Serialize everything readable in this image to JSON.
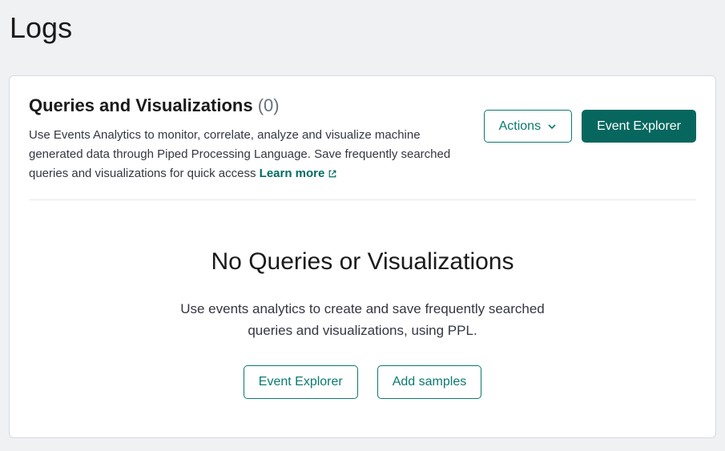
{
  "page": {
    "title": "Logs"
  },
  "panel": {
    "title": "Queries and Visualizations",
    "count": "(0)",
    "description": "Use Events Analytics to monitor, correlate, analyze and visualize machine generated data through Piped Processing Language. Save frequently searched queries and visualizations for quick access ",
    "learn_more_label": "Learn more",
    "actions_button": "Actions",
    "event_explorer_button": "Event Explorer"
  },
  "empty": {
    "title": "No Queries or Visualizations",
    "description": "Use events analytics to create and save frequently searched queries and visualizations, using PPL.",
    "event_explorer_button": "Event Explorer",
    "add_samples_button": "Add samples"
  }
}
